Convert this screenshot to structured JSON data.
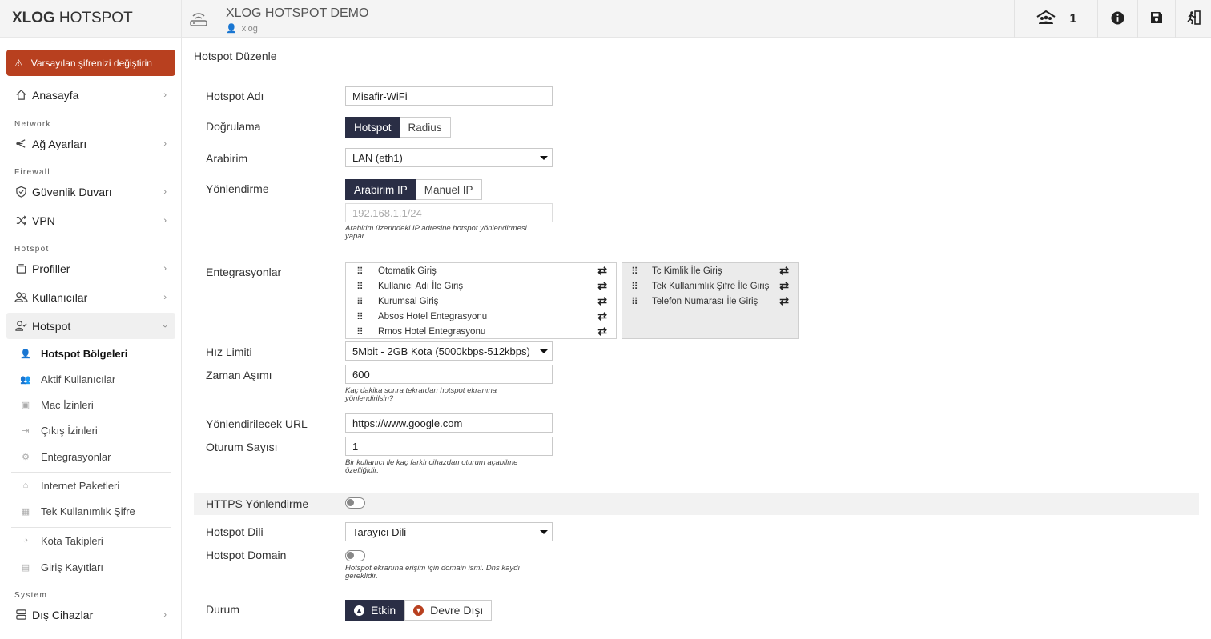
{
  "brand": {
    "bold": "XLOG",
    "light": "HOTSPOT"
  },
  "alert": {
    "text": "Varsayılan şifrenizi değiştirin"
  },
  "sidebar": {
    "home": "Anasayfa",
    "sections": {
      "network": "Network",
      "firewall": "Firewall",
      "hotspot": "Hotspot",
      "system": "System"
    },
    "network_settings": "Ağ Ayarları",
    "firewall": "Güvenlik Duvarı",
    "vpn": "VPN",
    "profiles": "Profiller",
    "users": "Kullanıcılar",
    "hotspot": "Hotspot",
    "sub": {
      "zones": "Hotspot Bölgeleri",
      "active_users": "Aktif Kullanıcılar",
      "mac": "Mac İzinleri",
      "exit": "Çıkış İzinleri",
      "integrations": "Entegrasyonlar",
      "packages": "İnternet Paketleri",
      "otp": "Tek Kullanımlık Şifre",
      "quota": "Kota Takipleri",
      "logins": "Giriş Kayıtları"
    },
    "external": "Dış Cihazlar"
  },
  "topbar": {
    "title": "XLOG HOTSPOT DEMO",
    "user": "xlog",
    "online_count": "1"
  },
  "page": {
    "title": "Hotspot Düzenle"
  },
  "form": {
    "name_label": "Hotspot Adı",
    "name_value": "Misafir-WiFi",
    "auth_label": "Doğrulama",
    "auth_options": [
      "Hotspot",
      "Radius"
    ],
    "iface_label": "Arabirim",
    "iface_value": "LAN (eth1)",
    "routing_label": "Yönlendirme",
    "routing_options": [
      "Arabirim IP",
      "Manuel IP"
    ],
    "routing_placeholder": "192.168.1.1/24",
    "routing_help": "Arabirim üzerindeki IP adresine hotspot yönlendirmesi yapar.",
    "integ_label": "Entegrasyonlar",
    "integ_available": [
      "Otomatik Giriş",
      "Kullanıcı Adı İle Giriş",
      "Kurumsal Giriş",
      "Absos Hotel Entegrasyonu",
      "Rmos Hotel Entegrasyonu"
    ],
    "integ_selected": [
      "Tc Kimlik İle Giriş",
      "Tek Kullanımlık Şifre İle Giriş",
      "Telefon Numarası İle Giriş"
    ],
    "speed_label": "Hız Limiti",
    "speed_value": "5Mbit - 2GB Kota (5000kbps-512kbps)",
    "timeout_label": "Zaman Aşımı",
    "timeout_value": "600",
    "timeout_help": "Kaç dakika sonra tekrardan hotspot ekranına yönlendirilsin?",
    "url_label": "Yönlendirilecek URL",
    "url_value": "https://www.google.com",
    "sessions_label": "Oturum Sayısı",
    "sessions_value": "1",
    "sessions_help": "Bir kullanıcı ile kaç farklı cihazdan oturum açabilme özelliğidir.",
    "https_label": "HTTPS Yönlendirme",
    "lang_label": "Hotspot Dili",
    "lang_value": "Tarayıcı Dili",
    "domain_label": "Hotspot Domain",
    "domain_help": "Hotspot ekranına erişim için domain ismi. Dns kaydı gereklidir.",
    "status_label": "Durum",
    "status_on": "Etkin",
    "status_off": "Devre Dışı"
  },
  "colors": {
    "accent": "#2a2e45",
    "alert": "#b8401f"
  }
}
